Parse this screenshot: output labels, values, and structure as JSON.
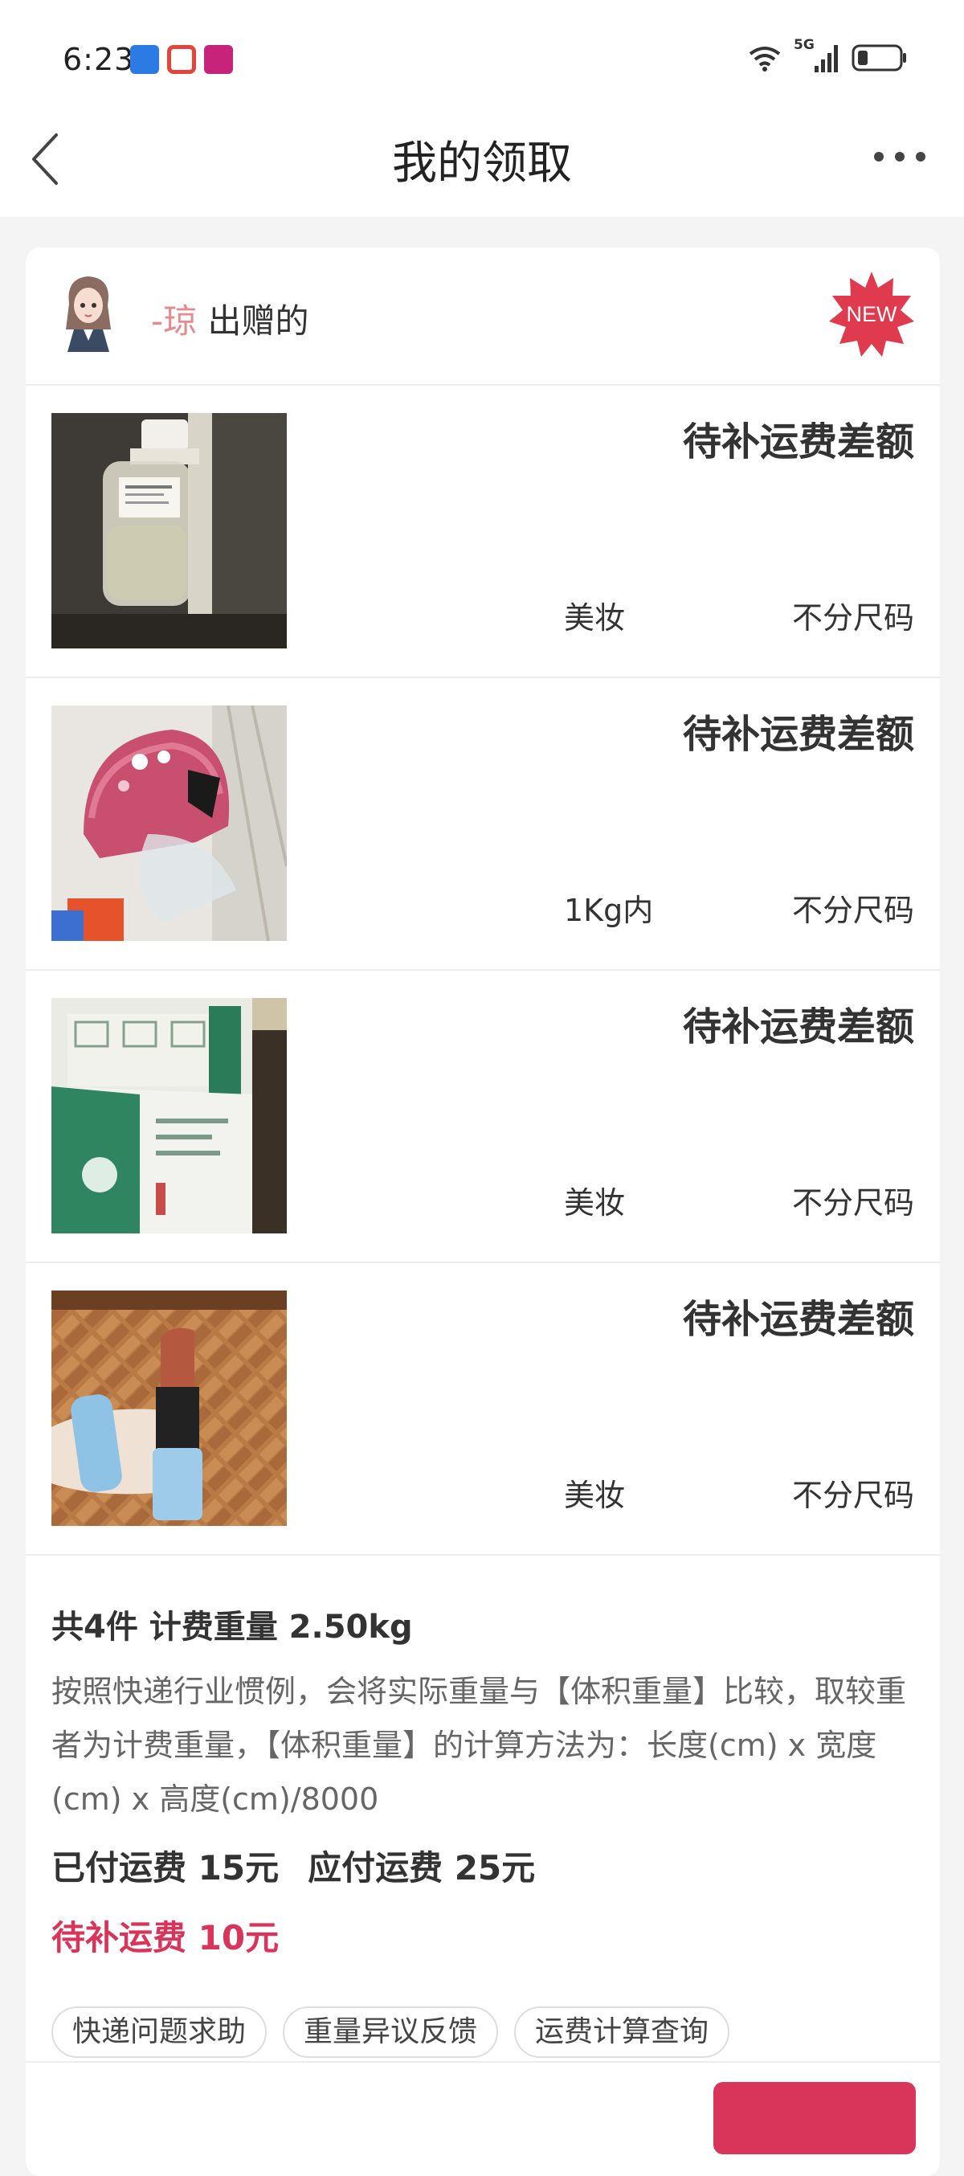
{
  "status_bar": {
    "time": "6:23",
    "signal_label": "5G"
  },
  "nav": {
    "title": "我的领取"
  },
  "giver": {
    "nickname": "-琼",
    "suffix": "出赠的",
    "badge": "NEW"
  },
  "items": [
    {
      "status": "待补运费差额",
      "category": "美妆",
      "size": "不分尺码"
    },
    {
      "status": "待补运费差额",
      "category": "1Kg内",
      "size": "不分尺码"
    },
    {
      "status": "待补运费差额",
      "category": "美妆",
      "size": "不分尺码"
    },
    {
      "status": "待补运费差额",
      "category": "美妆",
      "size": "不分尺码"
    }
  ],
  "summary": {
    "title": "共4件 计费重量 2.50kg",
    "note": "按照快递行业惯例，会将实际重量与【体积重量】比较，取较重者为计费重量，【体积重量】的计算方法为：长度(cm) x 宽度(cm) x 高度(cm)/8000",
    "paid": "已付运费 15元",
    "payable": "应付运费 25元",
    "due": "待补运费 10元"
  },
  "actions": [
    "快递问题求助",
    "重量异议反馈",
    "运费计算查询"
  ],
  "colors": {
    "accent": "#d9345a",
    "badge": "#e03a4f",
    "nickname": "#e48b8f"
  }
}
